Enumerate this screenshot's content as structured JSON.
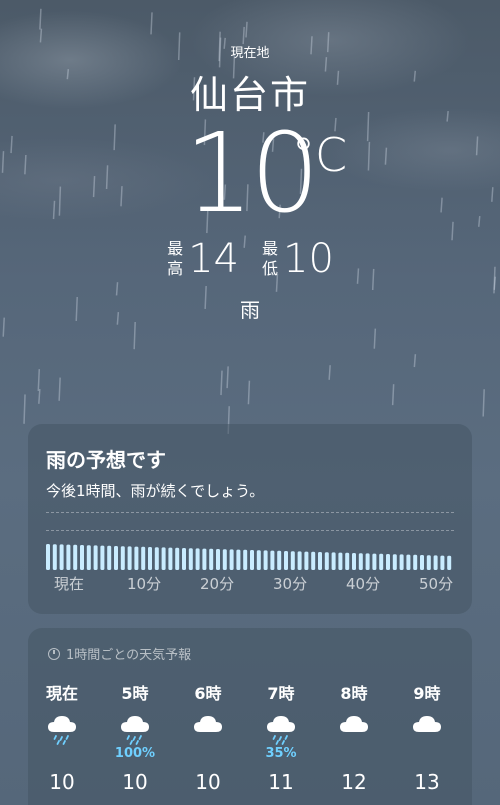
{
  "location_label": "現在地",
  "city": "仙台市",
  "temperature": "10",
  "unit": "°C",
  "high_label": "最高",
  "high": "14",
  "low_label": "最低",
  "low": "10",
  "condition": "雨",
  "rain_card": {
    "title": "雨の予想です",
    "subtitle": "今後1時間、雨が続くでしょう。",
    "ticks": [
      "現在",
      "10分",
      "20分",
      "30分",
      "40分",
      "50分"
    ]
  },
  "hourly": {
    "title": "1時間ごとの天気予報",
    "hours": [
      {
        "time": "現在",
        "icon": "rain-cloud-icon",
        "prob": "",
        "temp": "10"
      },
      {
        "time": "5時",
        "icon": "rain-cloud-icon",
        "prob": "100%",
        "temp": "10"
      },
      {
        "time": "6時",
        "icon": "cloud-icon",
        "prob": "",
        "temp": "10"
      },
      {
        "time": "7時",
        "icon": "rain-cloud-icon",
        "prob": "35%",
        "temp": "11"
      },
      {
        "time": "8時",
        "icon": "cloud-icon",
        "prob": "",
        "temp": "12"
      },
      {
        "time": "9時",
        "icon": "cloud-icon",
        "prob": "",
        "temp": "13"
      }
    ]
  },
  "colors": {
    "accent_rain": "#6fd0ff",
    "bar": "#c9ecff"
  }
}
